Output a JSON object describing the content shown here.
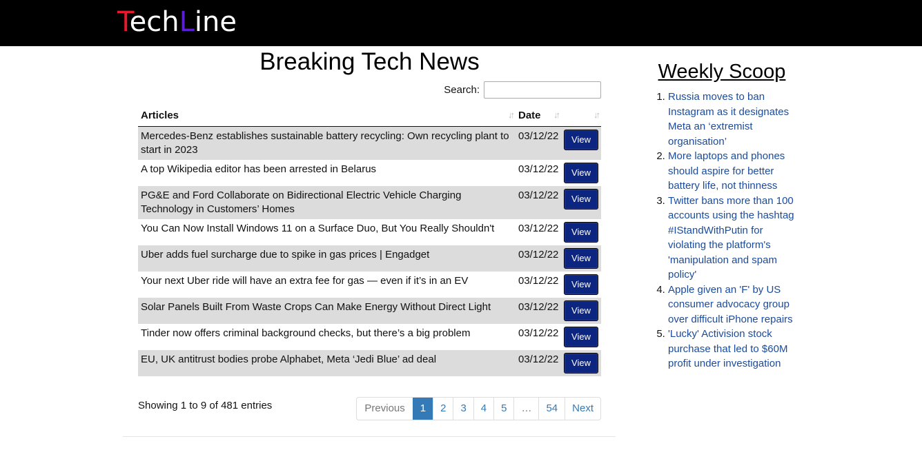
{
  "header": {
    "logo_parts": [
      {
        "text": "T",
        "color": "#e8192c"
      },
      {
        "text": "ech",
        "color": "#ffffff"
      },
      {
        "text": "L",
        "color": "#5b1fd6"
      },
      {
        "text": "ine",
        "color": "#ffffff"
      }
    ]
  },
  "main": {
    "title": "Breaking Tech News",
    "search_label": "Search:",
    "search_value": "",
    "columns": {
      "articles": "Articles",
      "date": "Date",
      "action": ""
    },
    "rows": [
      {
        "title": "Mercedes-Benz establishes sustainable battery recycling: Own recycling plant to start in 2023",
        "date": "03/12/22",
        "button": "View"
      },
      {
        "title": "A top Wikipedia editor has been arrested in Belarus",
        "date": "03/12/22",
        "button": "View"
      },
      {
        "title": "PG&E and Ford Collaborate on Bidirectional Electric Vehicle Charging Technology in Customers’ Homes",
        "date": "03/12/22",
        "button": "View"
      },
      {
        "title": "You Can Now Install Windows 11 on a Surface Duo, But You Really Shouldn't",
        "date": "03/12/22",
        "button": "View"
      },
      {
        "title": "Uber adds fuel surcharge due to spike in gas prices | Engadget",
        "date": "03/12/22",
        "button": "View"
      },
      {
        "title": "Your next Uber ride will have an extra fee for gas — even if it’s in an EV",
        "date": "03/12/22",
        "button": "View"
      },
      {
        "title": "Solar Panels Built From Waste Crops Can Make Energy Without Direct Light",
        "date": "03/12/22",
        "button": "View"
      },
      {
        "title": "Tinder now offers criminal background checks, but there’s a big problem",
        "date": "03/12/22",
        "button": "View"
      },
      {
        "title": "EU, UK antitrust bodies probe Alphabet, Meta ‘Jedi Blue’ ad deal",
        "date": "03/12/22",
        "button": "View"
      }
    ],
    "info": "Showing 1 to 9 of 481 entries",
    "pagination": [
      "Previous",
      "1",
      "2",
      "3",
      "4",
      "5",
      "…",
      "54",
      "Next"
    ],
    "active_page": "1"
  },
  "sidebar": {
    "title": "Weekly Scoop",
    "items": [
      "Russia moves to ban Instagram as it designates Meta an ‘extremist organisation’",
      "More laptops and phones should aspire for better battery life, not thinness",
      "Twitter bans more than 100 accounts using the hashtag #IStandWithPutin for violating the platform's 'manipulation and spam policy'",
      "Apple given an 'F' by US consumer advocacy group over difficult iPhone repairs",
      "'Lucky' Activision stock purchase that led to $60M profit under investigation"
    ]
  },
  "colors": {
    "topbar": "#000000",
    "button": "#0b2580",
    "link": "#1a4b9c",
    "pager_active": "#337ab7",
    "row_stripe": "#dcdcdc"
  },
  "icons": {
    "sort": "sort-arrows-icon"
  }
}
